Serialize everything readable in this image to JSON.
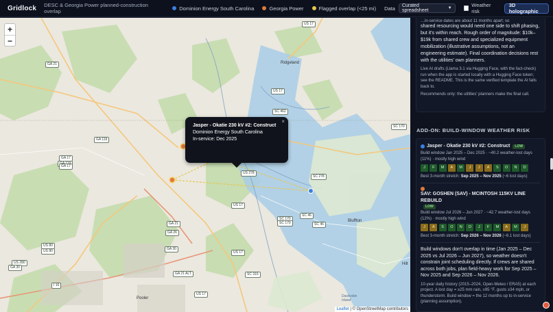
{
  "app": {
    "brand": "Gridlock",
    "subtitle": "DESC & Georgia Power planned-construction overlap"
  },
  "legend": [
    {
      "label": "Dominion Energy South Carolina",
      "color": "#3b7fe0"
    },
    {
      "label": "Georgia Power",
      "color": "#e07a3b"
    },
    {
      "label": "Flagged overlap (<25 mi)",
      "color": "#e5c74a"
    }
  ],
  "controls": {
    "data_label": "Data",
    "data_select": "Curated spreadsheet",
    "weather_label": "Weather risk",
    "holo_button": "3D holographic"
  },
  "map": {
    "zoom_in": "+",
    "zoom_out": "−",
    "attribution_leaflet": "Leaflet",
    "attribution_rest": "| © OpenStreetMap contributors",
    "towns": [
      "Ridgeland",
      "Bluffton",
      "Pooler",
      "Hilt",
      "Daufuskie Island"
    ],
    "shields": [
      "GA 21",
      "US 17",
      "GA 119",
      "US 17",
      "GA 17",
      "GA 119",
      "SC 462",
      "US 278",
      "SC 170",
      "SC 170",
      "SC 46",
      "US 17",
      "GA 21",
      "US 80",
      "US 80",
      "GA 26",
      "US 280",
      "GA 30",
      "I 16",
      "GA 21 ALT",
      "SC 315",
      "US 17",
      "SC 46",
      "SC 278",
      "US 17",
      "GA 30",
      "GA 17",
      "SC 170"
    ],
    "popup": {
      "title": "Jasper - Okatie 230 kV #2: Construct",
      "utility": "Dominion Energy South Carolina",
      "in_service": "In-service: Dec 2025",
      "close": "×"
    }
  },
  "panel": {
    "intro_partial": "shared resourcing would need one side to shift phasing, but it's within reach. Rough order of magnitude: $10k–$19k from shared crew and specialized equipment mobilization (illustrative assumptions, not an engineering estimate). Final coordination decisions rest with the utilities' own planners.",
    "intro_top_cut": "…in-service dates are about 11 months apart; so",
    "ai_note": "Live AI drafts (Llama 3.1 via Hugging Face, with the fact-check) run when the app is started locally with a Hugging Face token; see the README. This is the same verified template the AI falls back to.",
    "recommend": "Recommends only: the utilities' planners make the final call.",
    "addon_heading": "ADD-ON: BUILD-WINDOW WEATHER RISK",
    "projects": [
      {
        "color": "#3b7fe0",
        "title": "Jasper - Okatie 230 kV #2: Construct",
        "badge": "LOW",
        "meta": "Build window Jan 2025 – Dec 2025 · ~40.2 weather-lost days (11%) · mostly high wind",
        "months": [
          {
            "m": "J",
            "risk": "low"
          },
          {
            "m": "F",
            "risk": "low"
          },
          {
            "m": "M",
            "risk": "low"
          },
          {
            "m": "A",
            "risk": "mid"
          },
          {
            "m": "M",
            "risk": "low"
          },
          {
            "m": "J",
            "risk": "mid"
          },
          {
            "m": "J",
            "risk": "mid"
          },
          {
            "m": "A",
            "risk": "mid"
          },
          {
            "m": "S",
            "risk": "low"
          },
          {
            "m": "O",
            "risk": "low"
          },
          {
            "m": "N",
            "risk": "low"
          },
          {
            "m": "D",
            "risk": "low"
          }
        ],
        "best_label": "Best 3-month stretch:",
        "best_range": "Sep 2025 – Nov 2025",
        "best_days": "(~6 lost days)"
      },
      {
        "color": "#e07a3b",
        "title": "SAV: GOSHEN (SAV) - MCINTOSH 115KV LINE REBUILD",
        "badge": "LOW",
        "meta": "Build window Jul 2026 – Jun 2027 · ~42.7 weather-lost days (12%) · mostly high wind",
        "months": [
          {
            "m": "J",
            "risk": "mid"
          },
          {
            "m": "A",
            "risk": "mid"
          },
          {
            "m": "S",
            "risk": "low"
          },
          {
            "m": "O",
            "risk": "low"
          },
          {
            "m": "N",
            "risk": "low"
          },
          {
            "m": "D",
            "risk": "low"
          },
          {
            "m": "J",
            "risk": "low"
          },
          {
            "m": "F",
            "risk": "low"
          },
          {
            "m": "M",
            "risk": "low"
          },
          {
            "m": "A",
            "risk": "mid"
          },
          {
            "m": "M",
            "risk": "low"
          },
          {
            "m": "J",
            "risk": "mid"
          }
        ],
        "best_label": "Best 3-month stretch:",
        "best_range": "Sep 2026 – Nov 2026",
        "best_days": "(~6.1 lost days)"
      }
    ],
    "summary": "Build windows don't overlap in time (Jan 2025 – Dec 2025 vs Jul 2026 – Jun 2027), so weather doesn't constrain joint scheduling directly. If crews are shared across both jobs, plan field-heavy work for Sep 2025 – Nov 2025 and Sep 2026 – Nov 2026.",
    "method": "10-year daily history (2015–2024, Open-Meteo / ERA5) at each project. A lost day = ≥25 mm rain, ≥95 °F, gusts ≥34 mph, or thunderstorm. Build window = the 12 months up to in-service (planning assumption)."
  }
}
